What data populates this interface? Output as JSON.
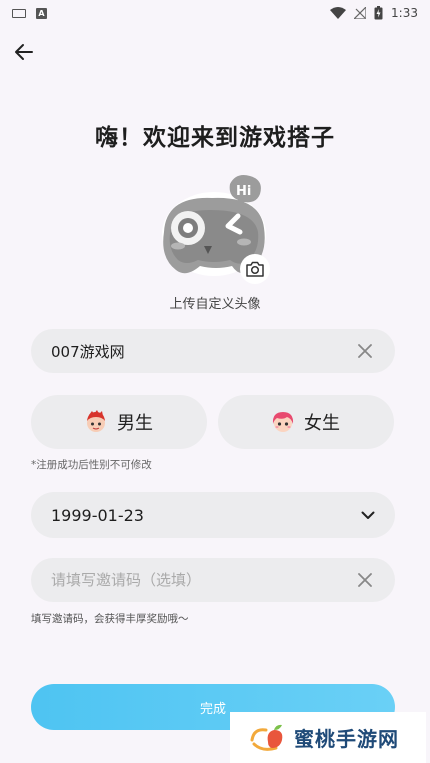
{
  "status_bar": {
    "time": "1:33",
    "icons": [
      "keyboard-icon",
      "a-icon",
      "wifi-icon",
      "no-signal-icon",
      "battery-charging-icon"
    ]
  },
  "header": {
    "back_icon": "arrow-left-icon"
  },
  "title": "嗨！欢迎来到游戏搭子",
  "avatar": {
    "upload_label": "上传自定义头像",
    "camera_icon": "camera-icon"
  },
  "form": {
    "nickname": {
      "value": "007游戏网",
      "clear_icon": "close-icon"
    },
    "gender": {
      "male_label": "男生",
      "female_label": "女生",
      "note": "*注册成功后性别不可修改"
    },
    "birthday": {
      "value": "1999-01-23",
      "icon": "chevron-down-icon"
    },
    "invite": {
      "placeholder": "请填写邀请码（选填）",
      "value": "",
      "note": "填写邀请码，会获得丰厚奖励哦～",
      "clear_icon": "close-icon"
    },
    "submit_label": "完成"
  },
  "watermark": {
    "text": "蜜桃手游网"
  },
  "colors": {
    "accent": "#5ccbf4",
    "field_bg": "#ececee",
    "page_bg": "#f8f5fa"
  }
}
